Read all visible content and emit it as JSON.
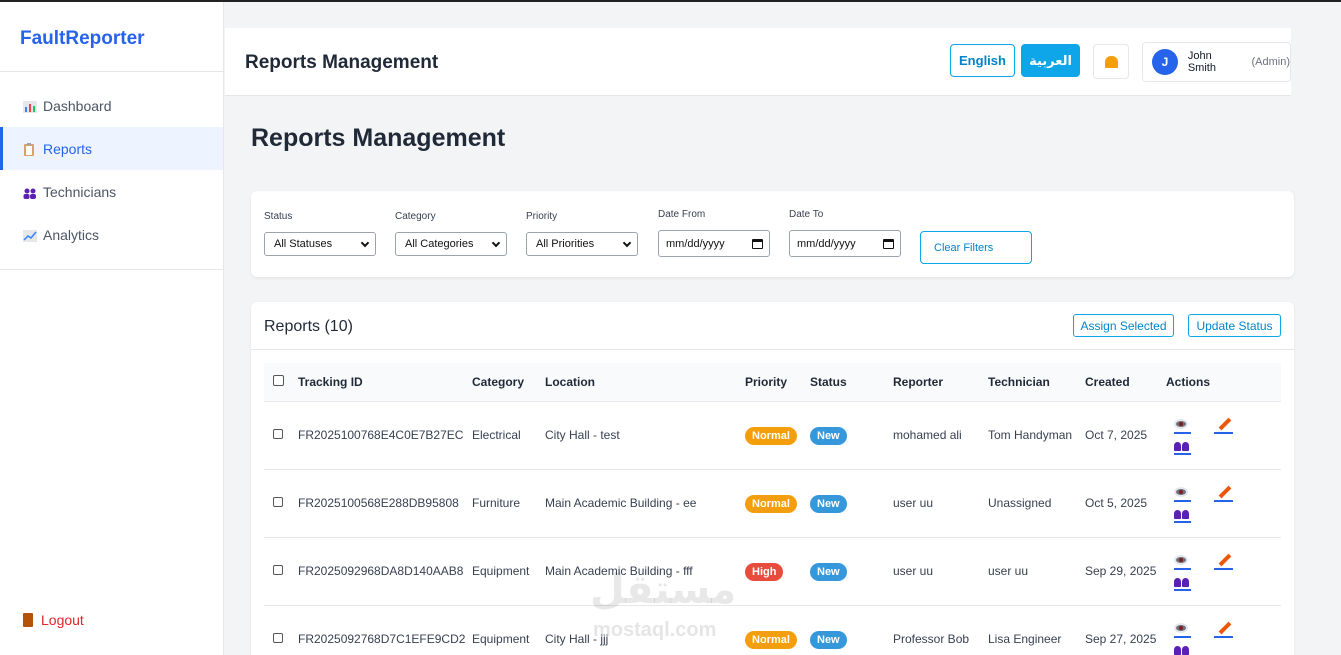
{
  "brand": "FaultReporter",
  "sidebar": {
    "items": [
      {
        "label": "Dashboard",
        "icon": "bar-chart-icon",
        "active": false
      },
      {
        "label": "Reports",
        "icon": "clipboard-icon",
        "active": true
      },
      {
        "label": "Technicians",
        "icon": "people-icon",
        "active": false
      },
      {
        "label": "Analytics",
        "icon": "line-chart-icon",
        "active": false
      }
    ],
    "logout": "Logout"
  },
  "topbar": {
    "title": "Reports Management",
    "lang_en": "English",
    "lang_ar": "العربية",
    "user_initial": "J",
    "user_name": "John Smith",
    "user_role": "(Admin)"
  },
  "page_heading": "Reports Management",
  "filters": {
    "status_label": "Status",
    "status_value": "All Statuses",
    "category_label": "Category",
    "category_value": "All Categories",
    "priority_label": "Priority",
    "priority_value": "All Priorities",
    "date_from_label": "Date From",
    "date_from_placeholder": "mm/dd/yyyy",
    "date_to_label": "Date To",
    "date_to_placeholder": "mm/dd/yyyy",
    "clear_label": "Clear Filters"
  },
  "reports": {
    "title": "Reports (10)",
    "assign_label": "Assign Selected",
    "update_label": "Update Status",
    "columns": [
      "Tracking ID",
      "Category",
      "Location",
      "Priority",
      "Status",
      "Reporter",
      "Technician",
      "Created",
      "Actions"
    ],
    "rows": [
      {
        "id": "FR2025100768E4C0E7B27EC",
        "category": "Electrical",
        "location": "City Hall - test",
        "priority": "Normal",
        "status": "New",
        "reporter": "mohamed ali",
        "technician": "Tom Handyman",
        "created": "Oct 7, 2025"
      },
      {
        "id": "FR2025100568E288DB95808",
        "category": "Furniture",
        "location": "Main Academic Building - ee",
        "priority": "Normal",
        "status": "New",
        "reporter": "user uu",
        "technician": "Unassigned",
        "created": "Oct 5, 2025"
      },
      {
        "id": "FR2025092968DA8D140AAB8",
        "category": "Equipment",
        "location": "Main Academic Building - fff",
        "priority": "High",
        "status": "New",
        "reporter": "user uu",
        "technician": "user uu",
        "created": "Sep 29, 2025"
      },
      {
        "id": "FR2025092768D7C1EFE9CD2",
        "category": "Equipment",
        "location": "City Hall - jjj",
        "priority": "Normal",
        "status": "New",
        "reporter": "Professor Bob",
        "technician": "Lisa Engineer",
        "created": "Sep 27, 2025"
      }
    ]
  },
  "colors": {
    "accent": "#2563eb",
    "sky": "#0ea5e9",
    "priority_normal": "#f59e0b",
    "priority_high": "#e74c3c",
    "status_new": "#3498db"
  },
  "watermark": {
    "arabic": "مستقل",
    "latin": "mostaql.com"
  }
}
